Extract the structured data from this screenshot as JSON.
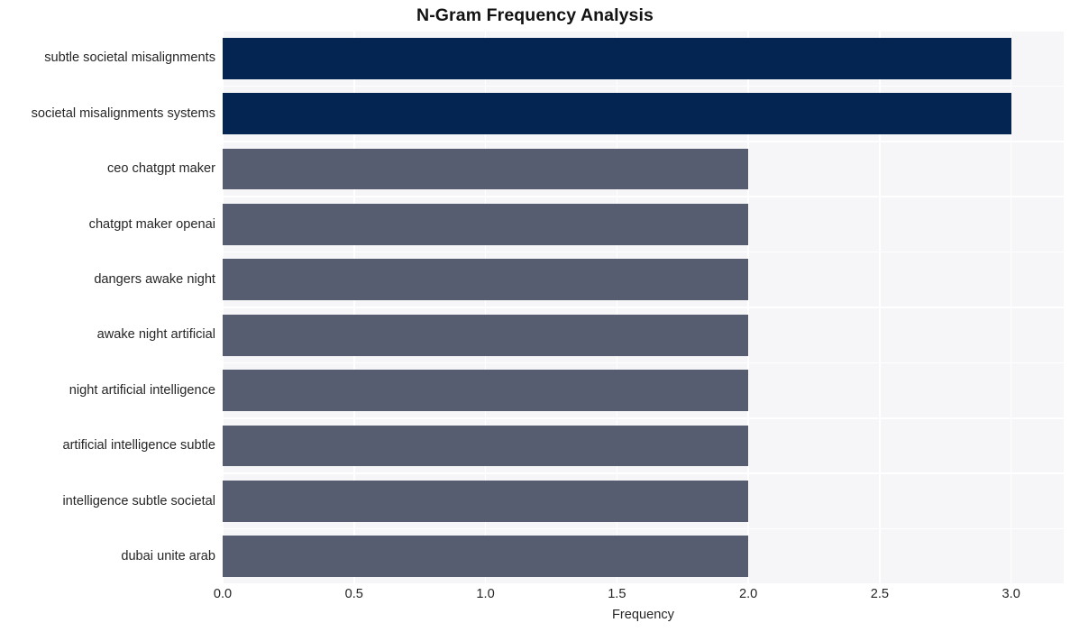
{
  "chart_data": {
    "type": "bar",
    "orientation": "horizontal",
    "title": "N-Gram Frequency Analysis",
    "xlabel": "Frequency",
    "ylabel": "",
    "xlim": [
      0.0,
      3.2
    ],
    "xticks": [
      "0.0",
      "0.5",
      "1.0",
      "1.5",
      "2.0",
      "2.5",
      "3.0"
    ],
    "xtick_values": [
      0.0,
      0.5,
      1.0,
      1.5,
      2.0,
      2.5,
      3.0
    ],
    "grid": true,
    "legend": "none",
    "categories": [
      "subtle societal misalignments",
      "societal misalignments systems",
      "ceo chatgpt maker",
      "chatgpt maker openai",
      "dangers awake night",
      "awake night artificial",
      "night artificial intelligence",
      "artificial intelligence subtle",
      "intelligence subtle societal",
      "dubai unite arab"
    ],
    "values": [
      3,
      3,
      2,
      2,
      2,
      2,
      2,
      2,
      2,
      2
    ],
    "bar_colors": [
      "#042552",
      "#042552",
      "#565d70",
      "#565d70",
      "#565d70",
      "#565d70",
      "#565d70",
      "#565d70",
      "#565d70",
      "#565d70"
    ]
  },
  "style": {
    "figure_background": "#ffffff",
    "plot_background": "#f6f5f7",
    "gridline_color": "#ffffff",
    "title_color": "#121212",
    "tick_label_color": "#262626",
    "accent_high": "#042552",
    "accent_low": "#565d70"
  }
}
